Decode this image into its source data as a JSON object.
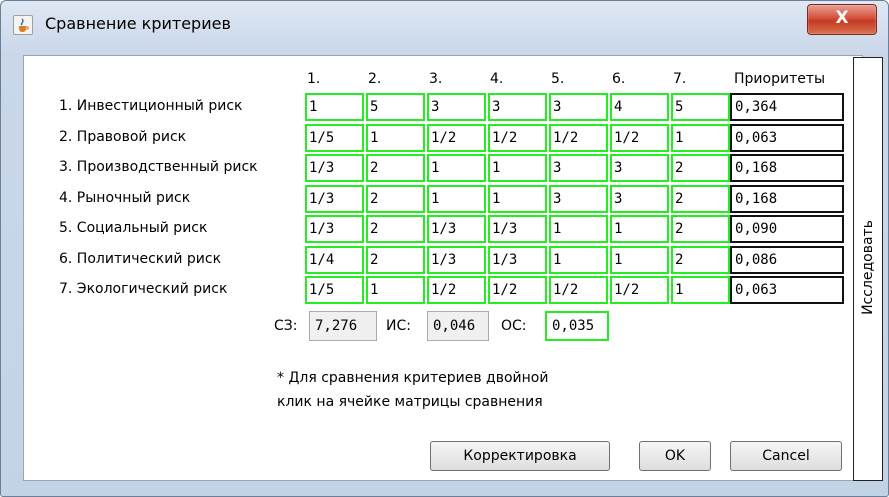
{
  "window": {
    "title": "Сравнение критериев",
    "close_glyph": "X"
  },
  "matrix": {
    "columns": [
      "1.",
      "2.",
      "3.",
      "4.",
      "5.",
      "6.",
      "7."
    ],
    "priorities_header": "Приоритеты",
    "rows": [
      {
        "label": "1. Инвестиционный риск",
        "cells": [
          "1",
          "5",
          "3",
          "3",
          "3",
          "4",
          "5"
        ],
        "priority": "0,364"
      },
      {
        "label": "2. Правовой риск",
        "cells": [
          "1/5",
          "1",
          "1/2",
          "1/2",
          "1/2",
          "1/2",
          "1"
        ],
        "priority": "0,063"
      },
      {
        "label": "3. Производственный риск",
        "cells": [
          "1/3",
          "2",
          "1",
          "1",
          "3",
          "3",
          "2"
        ],
        "priority": "0,168"
      },
      {
        "label": "4. Рыночный риск",
        "cells": [
          "1/3",
          "2",
          "1",
          "1",
          "3",
          "3",
          "2"
        ],
        "priority": "0,168"
      },
      {
        "label": "5. Социальный риск",
        "cells": [
          "1/3",
          "2",
          "1/3",
          "1/3",
          "1",
          "1",
          "2"
        ],
        "priority": "0,090"
      },
      {
        "label": "6. Политический риск",
        "cells": [
          "1/4",
          "2",
          "1/3",
          "1/3",
          "1",
          "1",
          "2"
        ],
        "priority": "0,086"
      },
      {
        "label": "7. Экологический риск",
        "cells": [
          "1/5",
          "1",
          "1/2",
          "1/2",
          "1/2",
          "1/2",
          "1"
        ],
        "priority": "0,063"
      }
    ]
  },
  "stats": {
    "sz_label": "СЗ:",
    "sz_value": "7,276",
    "is_label": "ИС:",
    "is_value": "0,046",
    "os_label": "ОС:",
    "os_value": "0,035"
  },
  "note": {
    "line1": "* Для сравнения критериев двойной",
    "line2": "клик на ячейке матрицы сравнения"
  },
  "buttons": {
    "correct": "Корректировка",
    "ok": "OK",
    "cancel": "Cancel"
  },
  "side_button": "Исследовать",
  "colors": {
    "cell_border": "#22ee22",
    "priority_border": "#111111",
    "close_button": "#c43a24"
  }
}
